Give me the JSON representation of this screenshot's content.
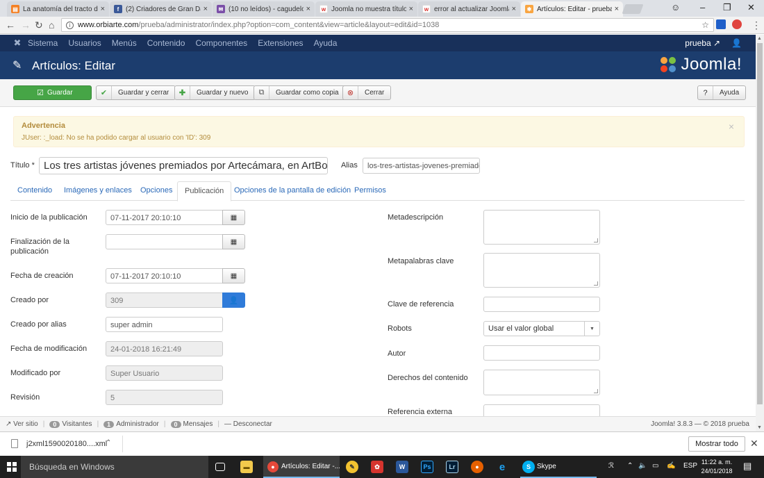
{
  "browser": {
    "tabs": [
      {
        "title": "La anatomía del tracto d",
        "color": "#f48024",
        "glyph": "▤"
      },
      {
        "title": "(2) Criadores de Gran Da",
        "color": "#3b5998",
        "glyph": "f"
      },
      {
        "title": "(10 no leídos) - cagudelo",
        "color": "#7b4fa8",
        "glyph": "✉"
      },
      {
        "title": "Joomla no muestra título",
        "color": "#ffffff",
        "glyph": "w"
      },
      {
        "title": "error al actualizar Joomla",
        "color": "#ffffff",
        "glyph": "w"
      },
      {
        "title": "Artículos: Editar - prueba",
        "color": "#f9a541",
        "glyph": "✱"
      }
    ],
    "close_glyph": "×",
    "url_host": "www.orbiarte.com",
    "url_path": "/prueba/administrator/index.php?option=com_content&view=article&layout=edit&id=1038"
  },
  "joomla_nav": {
    "items": [
      "Sistema",
      "Usuarios",
      "Menús",
      "Contenido",
      "Componentes",
      "Extensiones",
      "Ayuda"
    ],
    "user": "prueba"
  },
  "header": {
    "title": "Artículos: Editar",
    "logo_text": "Joomla!"
  },
  "toolbar": {
    "save": "Guardar",
    "save_close": "Guardar y cerrar",
    "save_new": "Guardar y nuevo",
    "save_copy": "Guardar como copia",
    "close": "Cerrar",
    "help": "Ayuda"
  },
  "warning": {
    "heading": "Advertencia",
    "message": "JUser: :_load: No se ha podido cargar al usuario con 'ID': 309"
  },
  "article": {
    "title_label": "Título *",
    "title_value": "Los tres artistas jóvenes premiados por Artecámara, en ArtBo",
    "alias_label": "Alias",
    "alias_value": "los-tres-artistas-jovenes-premiados-"
  },
  "tabs": [
    "Contenido",
    "Imágenes y enlaces",
    "Opciones",
    "Publicación",
    "Opciones de la pantalla de edición",
    "Permisos"
  ],
  "active_tab": "Publicación",
  "publishing": {
    "publish_up_label": "Inicio de la publicación",
    "publish_up_value": "07-11-2017 20:10:10",
    "publish_down_label_1": "Finalización de la",
    "publish_down_label_2": "publicación",
    "publish_down_value": "",
    "created_label": "Fecha de creación",
    "created_value": "07-11-2017 20:10:10",
    "created_by_label": "Creado por",
    "created_by_value": "309",
    "created_by_alias_label": "Creado por alias",
    "created_by_alias_value": "super admin",
    "modified_label": "Fecha de modificación",
    "modified_value": "24-01-2018 16:21:49",
    "modified_by_label": "Modificado por",
    "modified_by_value": "Super Usuario",
    "revision_label": "Revisión",
    "revision_value": "5"
  },
  "metadata": {
    "metadesc_label": "Metadescripción",
    "metakey_label": "Metapalabras clave",
    "xreference_label": "Clave de referencia",
    "robots_label": "Robots",
    "robots_value": "Usar el valor global",
    "author_label": "Autor",
    "rights_label": "Derechos del contenido",
    "external_ref_label": "Referencia externa"
  },
  "statusbar": {
    "view_site": "Ver sitio",
    "visitors_count": "0",
    "visitors_label": "Visitantes",
    "admin_count": "1",
    "admin_label": "Administrador",
    "messages_count": "0",
    "messages_label": "Mensajes",
    "logout": "Desconectar",
    "version": "Joomla! 3.8.3 — © 2018 prueba"
  },
  "download": {
    "filename": "j2xml1590020180....xml",
    "show_all": "Mostrar todo"
  },
  "taskbar": {
    "search_placeholder": "Búsqueda en Windows",
    "active_app": "Artículos: Editar -...",
    "skype": "Skype",
    "lang": "ESP",
    "time": "11:22 a. m.",
    "date": "24/01/2018"
  }
}
